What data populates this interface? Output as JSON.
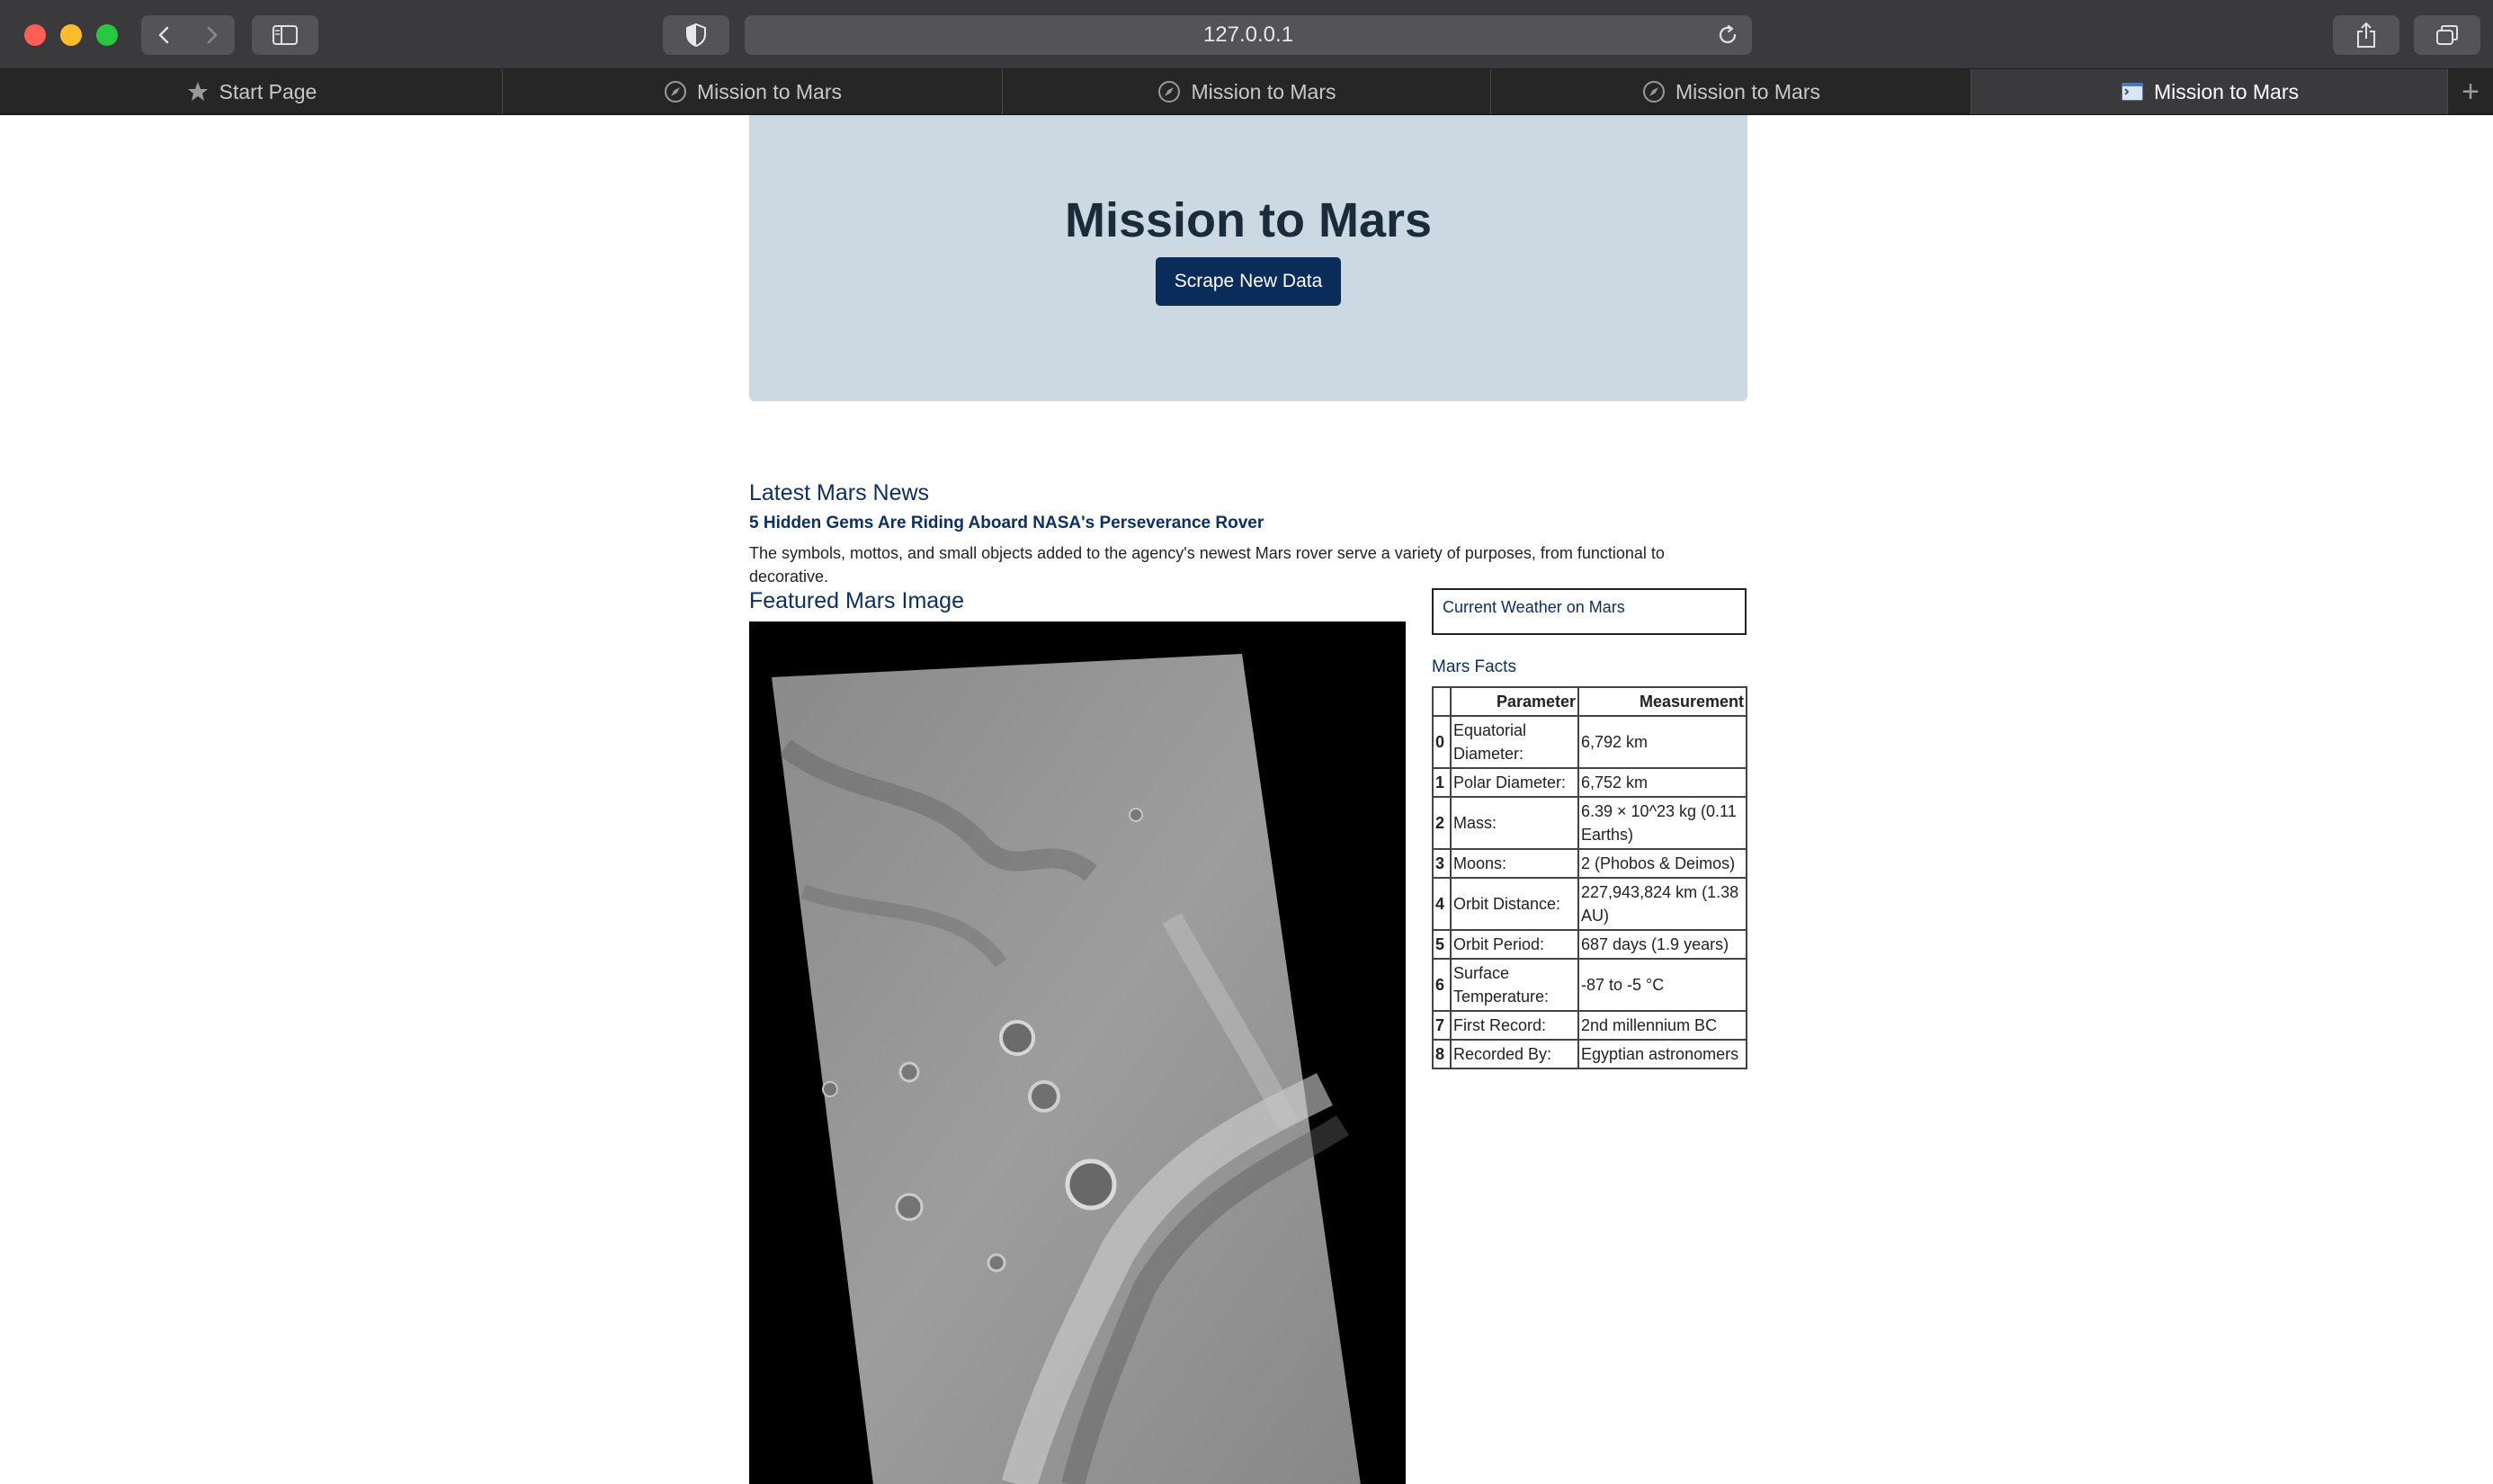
{
  "browser": {
    "url": "127.0.0.1",
    "tabs": [
      {
        "label": "Start Page",
        "icon": "star-icon"
      },
      {
        "label": "Mission to Mars",
        "icon": "compass-icon"
      },
      {
        "label": "Mission to Mars",
        "icon": "compass-icon"
      },
      {
        "label": "Mission to Mars",
        "icon": "compass-icon"
      },
      {
        "label": "Mission to Mars",
        "icon": "terminal-icon",
        "active": true
      }
    ],
    "new_tab_label": "+"
  },
  "jumbotron": {
    "title": "Mission to Mars",
    "button_label": "Scrape New Data",
    "background": "#ccd9e3",
    "button_color": "#0a2c5a"
  },
  "news": {
    "heading": "Latest Mars News",
    "title": "5 Hidden Gems Are Riding Aboard NASA's Perseverance Rover",
    "paragraph": "The symbols, mottos, and small objects added to the agency's newest Mars rover serve a variety of purposes, from functional to decorative."
  },
  "featured_image": {
    "heading": "Featured Mars Image"
  },
  "weather": {
    "heading": "Current Weather on Mars"
  },
  "facts": {
    "heading": "Mars Facts",
    "columns": [
      "Parameter",
      "Measurement"
    ],
    "rows": [
      {
        "idx": "0",
        "param": "Equatorial Diameter:",
        "value": "6,792 km"
      },
      {
        "idx": "1",
        "param": "Polar Diameter:",
        "value": "6,752 km"
      },
      {
        "idx": "2",
        "param": "Mass:",
        "value": "6.39 × 10^23 kg (0.11 Earths)"
      },
      {
        "idx": "3",
        "param": "Moons:",
        "value": "2 (Phobos & Deimos)"
      },
      {
        "idx": "4",
        "param": "Orbit Distance:",
        "value": "227,943,824 km (1.38 AU)"
      },
      {
        "idx": "5",
        "param": "Orbit Period:",
        "value": "687 days (1.9 years)"
      },
      {
        "idx": "6",
        "param": "Surface Temperature:",
        "value": "-87 to -5 °C"
      },
      {
        "idx": "7",
        "param": "First Record:",
        "value": "2nd millennium BC"
      },
      {
        "idx": "8",
        "param": "Recorded By:",
        "value": "Egyptian astronomers"
      }
    ]
  }
}
